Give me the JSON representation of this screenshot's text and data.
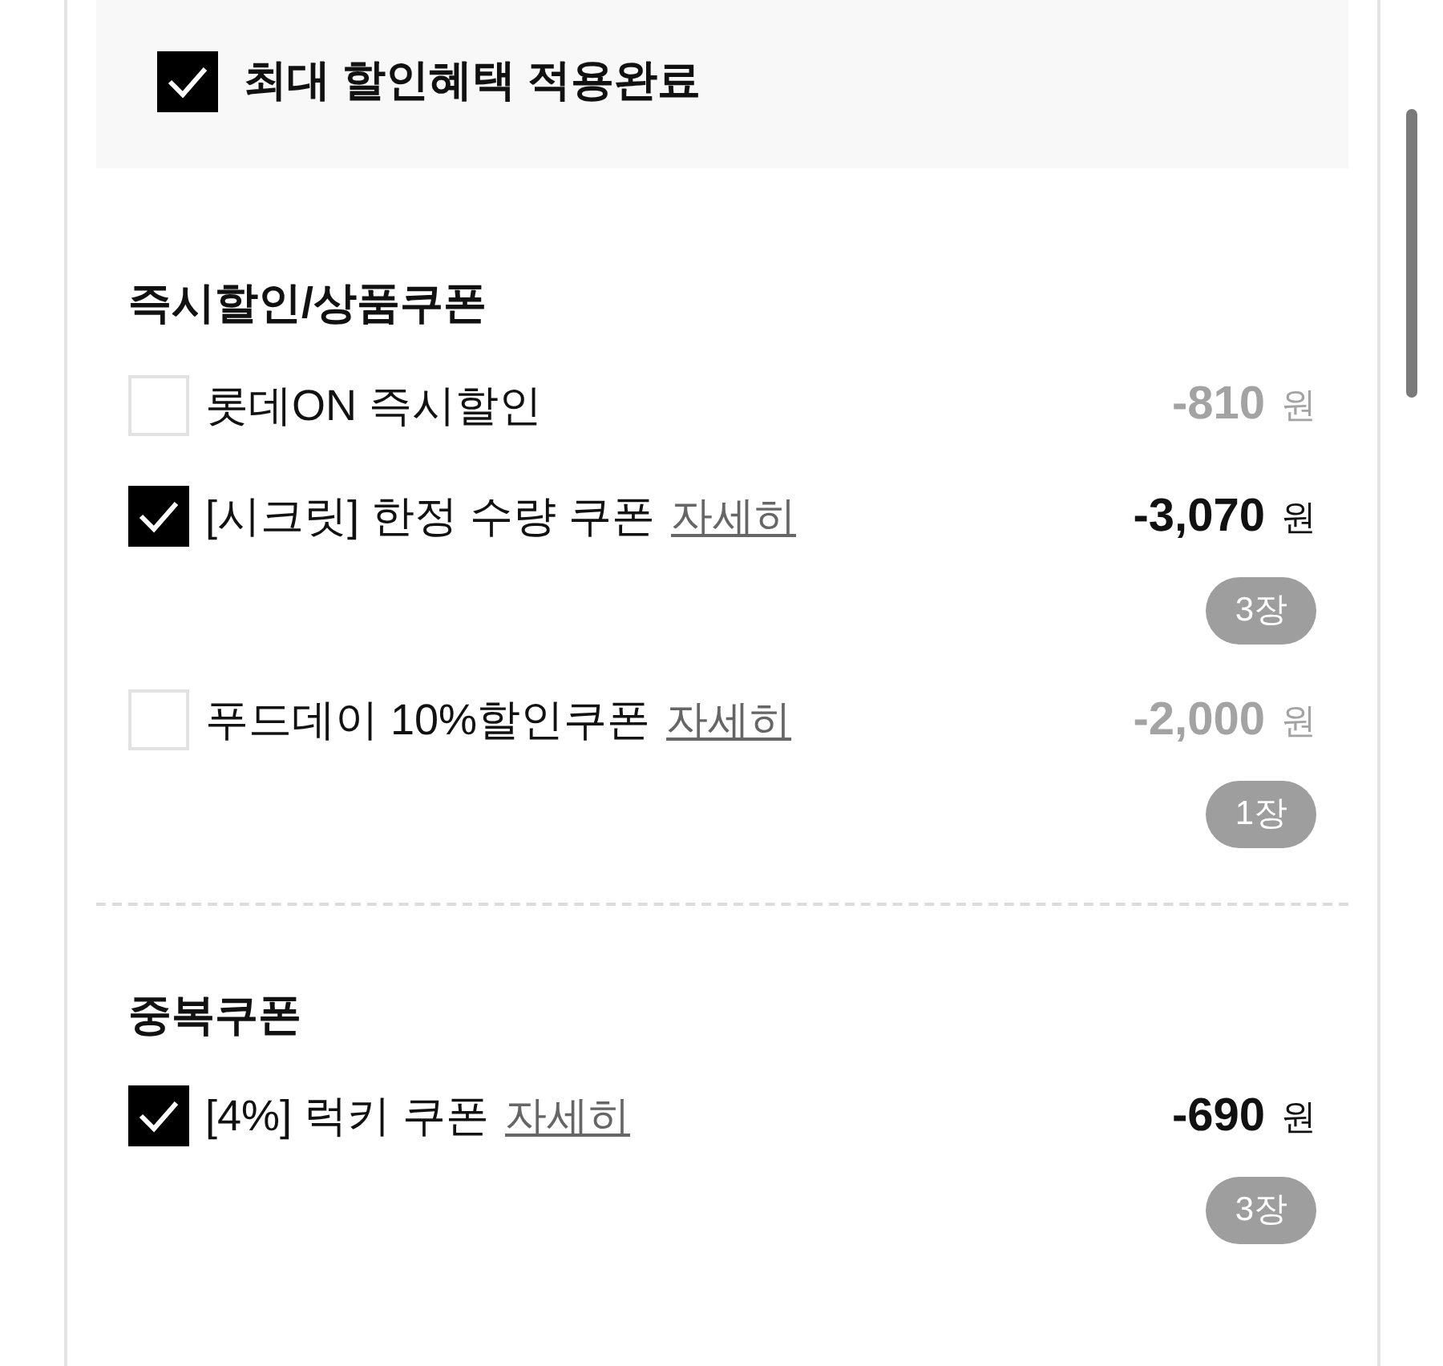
{
  "header": {
    "label": "최대 할인혜택 적용완료",
    "checked": true
  },
  "sections": [
    {
      "title": "즉시할인/상품쿠폰",
      "items": [
        {
          "label": "롯데ON 즉시할인",
          "checked": false,
          "amount": "-810",
          "unit": "원"
        },
        {
          "label": "[시크릿] 한정 수량 쿠폰",
          "detail": "자세히",
          "checked": true,
          "amount": "-3,070",
          "unit": "원",
          "count": "3장"
        },
        {
          "label": "푸드데이 10%할인쿠폰",
          "detail": "자세히",
          "checked": false,
          "amount": "-2,000",
          "unit": "원",
          "count": "1장"
        }
      ]
    },
    {
      "title": "중복쿠폰",
      "items": [
        {
          "label": "[4%] 럭키 쿠폰",
          "detail": "자세히",
          "checked": true,
          "amount": "-690",
          "unit": "원",
          "count": "3장"
        }
      ]
    }
  ]
}
